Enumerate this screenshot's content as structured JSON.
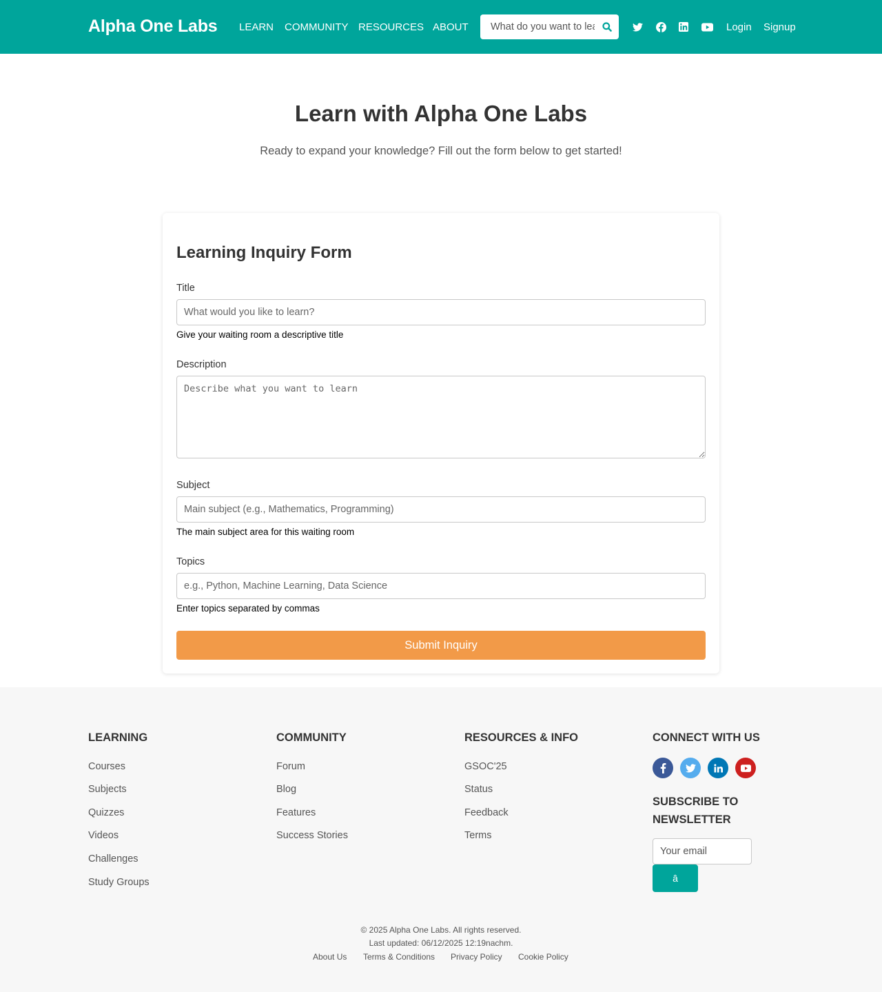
{
  "header": {
    "logo": "Alpha One Labs",
    "nav": [
      "LEARN",
      "COMMUNITY",
      "RESOURCES",
      "ABOUT"
    ],
    "search_placeholder": "What do you want to learn?",
    "social_icons": [
      "twitter-icon",
      "facebook-icon",
      "linkedin-icon",
      "youtube-icon"
    ],
    "login": "Login",
    "signup": "Signup",
    "bg_color": "#00a59b"
  },
  "hero": {
    "title": "Learn with Alpha One Labs",
    "subtitle": "Ready to expand your knowledge? Fill out the form below to get started!"
  },
  "form": {
    "heading": "Learning Inquiry Form",
    "title_label": "Title",
    "title_placeholder": "What would you like to learn?",
    "title_help": "Give your waiting room a descriptive title",
    "description_label": "Description",
    "description_placeholder": "Describe what you want to learn",
    "subject_label": "Subject",
    "subject_placeholder": "Main subject (e.g., Mathematics, Programming)",
    "subject_help": "The main subject area for this waiting room",
    "topics_label": "Topics",
    "topics_placeholder": "e.g., Python, Machine Learning, Data Science",
    "topics_help": "Enter topics separated by commas",
    "submit": "Submit Inquiry",
    "submit_color": "#f29a48"
  },
  "footer": {
    "learning": {
      "heading": "LEARNING",
      "links": [
        "Courses",
        "Subjects",
        "Quizzes",
        "Videos",
        "Challenges",
        "Study Groups"
      ]
    },
    "community": {
      "heading": "COMMUNITY",
      "links": [
        "Forum",
        "Blog",
        "Features",
        "Success Stories"
      ]
    },
    "resources": {
      "heading": "RESOURCES & INFO",
      "links": [
        "GSOC'25",
        "Status",
        "Feedback",
        "Terms"
      ]
    },
    "connect": {
      "heading": "CONNECT WITH US",
      "social": [
        {
          "icon": "facebook-icon",
          "color": "#3b5998"
        },
        {
          "icon": "twitter-icon",
          "color": "#55acee"
        },
        {
          "icon": "linkedin-icon",
          "color": "#0077b5"
        },
        {
          "icon": "youtube-icon",
          "color": "#cd201f"
        }
      ],
      "newsletter_heading": "SUBSCRIBE TO NEWSLETTER",
      "email_placeholder": "Your email",
      "subscribe_button": "â"
    },
    "copyright": "© 2025 Alpha One Labs. All rights reserved.",
    "last_updated": "Last updated: 06/12/2025 12:19nachm.",
    "bottom_links": [
      "About Us",
      "Terms & Conditions",
      "Privacy Policy",
      "Cookie Policy"
    ]
  }
}
